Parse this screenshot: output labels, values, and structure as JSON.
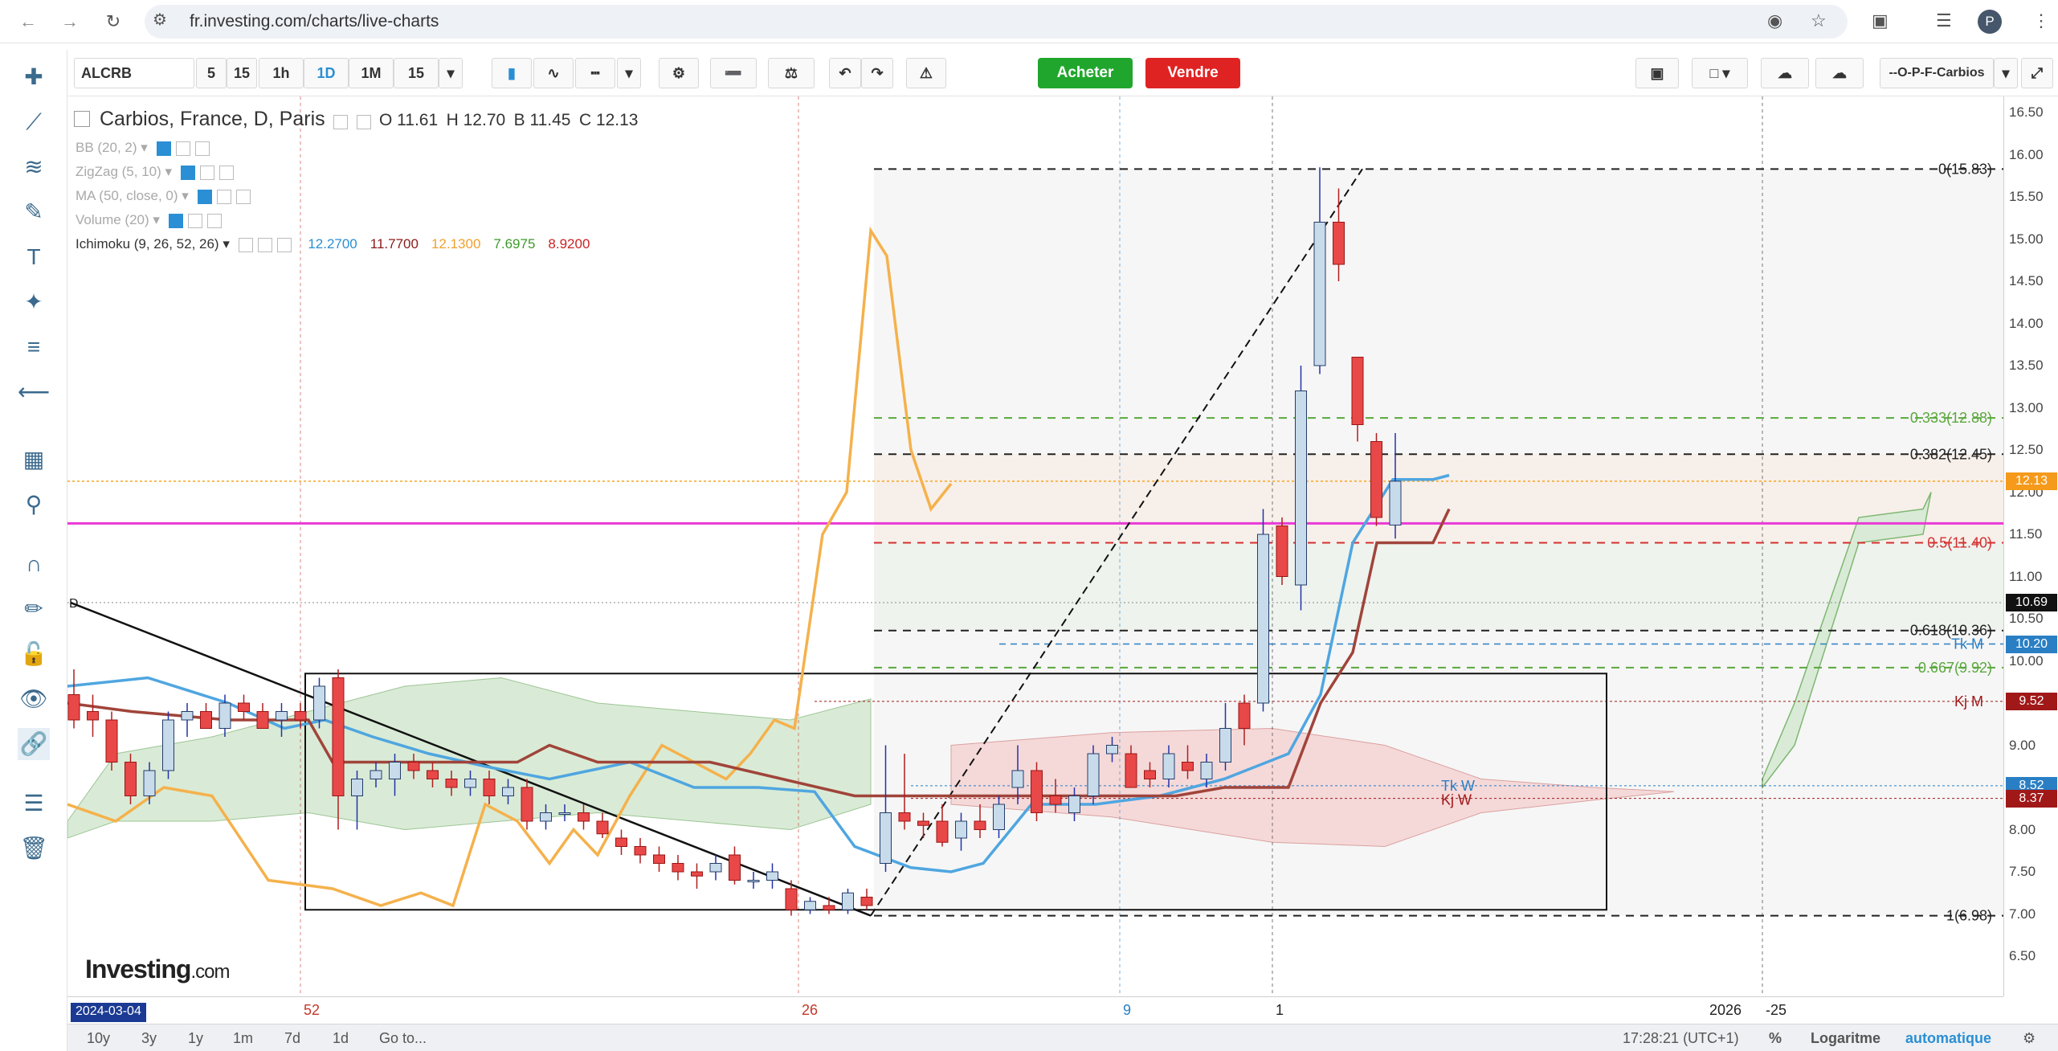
{
  "browser": {
    "url": "fr.investing.com/charts/live-charts",
    "profile_initial": "P"
  },
  "toolbar": {
    "symbol": "ALCRB",
    "intervals": [
      "5",
      "15",
      "1h",
      "1D",
      "1M",
      "15"
    ],
    "active_interval": "1D",
    "buy_label": "Acheter",
    "sell_label": "Vendre",
    "layout_name": "--O-P-F-Carbios"
  },
  "legend": {
    "title": "Carbios, France, D, Paris",
    "ohlc": {
      "open": "O 11.61",
      "high": "H 12.70",
      "low": "B 11.45",
      "close": "C 12.13"
    },
    "indicators": [
      {
        "label": "BB (20, 2)"
      },
      {
        "label": "ZigZag (5, 10)"
      },
      {
        "label": "MA (50, close, 0)"
      },
      {
        "label": "Volume (20)"
      },
      {
        "label": "Ichimoku (9, 26, 52, 26)"
      }
    ],
    "ichimoku_values": [
      {
        "value": "12.2700",
        "color": "#2a8fd4"
      },
      {
        "value": "11.7700",
        "color": "#8b1a1a"
      },
      {
        "value": "12.1300",
        "color": "#f0a030"
      },
      {
        "value": "7.6975",
        "color": "#3d9a2a"
      },
      {
        "value": "8.9200",
        "color": "#cc2222"
      }
    ]
  },
  "price_axis": {
    "ticks": [
      "16.50",
      "16.00",
      "15.50",
      "15.00",
      "14.50",
      "14.00",
      "13.50",
      "13.00",
      "12.50",
      "12.00",
      "11.50",
      "11.00",
      "10.50",
      "10.00",
      "9.50",
      "9.00",
      "8.50",
      "8.00",
      "7.50",
      "7.00",
      "6.50"
    ],
    "tags": [
      {
        "label": "12.13",
        "color": "#f59a1b"
      },
      {
        "label": "10.69",
        "color": "#111111"
      },
      {
        "label": "10.20",
        "color": "#2a7fc4"
      },
      {
        "label": "9.52",
        "color": "#a01818"
      },
      {
        "label": "8.52",
        "color": "#2a7fc4"
      },
      {
        "label": "8.37",
        "color": "#a01818"
      }
    ]
  },
  "fib_levels": [
    {
      "label": "0(15.83)",
      "color": "#222222"
    },
    {
      "label": "0.333(12.88)",
      "color": "#5aa83c"
    },
    {
      "label": "0.382(12.45)",
      "color": "#222222"
    },
    {
      "label": "0.5(11.40)",
      "color": "#d43030"
    },
    {
      "label": "0.618(10.36)",
      "color": "#222222"
    },
    {
      "label": "0.667(9.92)",
      "color": "#5aa83c"
    },
    {
      "label": "1(6.98)",
      "color": "#222222"
    }
  ],
  "chart_annotations": {
    "tk_m": "Tk M",
    "kj_m": "Kj M",
    "tk_w": "Tk W",
    "kj_w": "Kj W",
    "d_marker": "D"
  },
  "time_axis": {
    "labels": [
      {
        "label": "52",
        "color": "#c0392b"
      },
      {
        "label": "26",
        "color": "#c0392b"
      },
      {
        "label": "9",
        "color": "#2a7fc4"
      },
      {
        "label": "1",
        "color": "#222222"
      },
      {
        "label": "2026",
        "color": "#222222"
      },
      {
        "label": "-25",
        "color": "#222222"
      }
    ],
    "start_date": "2024-03-04"
  },
  "footer": {
    "ranges": [
      "10y",
      "3y",
      "1y",
      "1m",
      "7d",
      "1d",
      "Go to..."
    ],
    "clock": "17:28:21 (UTC+1)",
    "percent": "%",
    "log": "Logaritme",
    "auto": "automatique"
  },
  "logo": {
    "main": "Investing",
    "suffix": ".com"
  },
  "chart_data": {
    "type": "candlestick",
    "title": "Carbios, France, D, Paris",
    "ylim": [
      6.5,
      16.5
    ],
    "candles": [
      {
        "o": 9.6,
        "h": 9.9,
        "l": 9.2,
        "c": 9.3
      },
      {
        "o": 9.4,
        "h": 9.6,
        "l": 9.1,
        "c": 9.3
      },
      {
        "o": 9.3,
        "h": 9.4,
        "l": 8.7,
        "c": 8.8
      },
      {
        "o": 8.8,
        "h": 8.9,
        "l": 8.3,
        "c": 8.4
      },
      {
        "o": 8.4,
        "h": 8.8,
        "l": 8.3,
        "c": 8.7
      },
      {
        "o": 8.7,
        "h": 9.4,
        "l": 8.6,
        "c": 9.3
      },
      {
        "o": 9.3,
        "h": 9.5,
        "l": 9.1,
        "c": 9.4
      },
      {
        "o": 9.4,
        "h": 9.5,
        "l": 9.2,
        "c": 9.2
      },
      {
        "o": 9.2,
        "h": 9.6,
        "l": 9.1,
        "c": 9.5
      },
      {
        "o": 9.5,
        "h": 9.6,
        "l": 9.3,
        "c": 9.4
      },
      {
        "o": 9.4,
        "h": 9.5,
        "l": 9.2,
        "c": 9.2
      },
      {
        "o": 9.3,
        "h": 9.5,
        "l": 9.1,
        "c": 9.4
      },
      {
        "o": 9.4,
        "h": 9.5,
        "l": 9.2,
        "c": 9.3
      },
      {
        "o": 9.3,
        "h": 9.8,
        "l": 9.2,
        "c": 9.7
      },
      {
        "o": 9.8,
        "h": 9.9,
        "l": 8.0,
        "c": 8.4
      },
      {
        "o": 8.4,
        "h": 8.7,
        "l": 8.0,
        "c": 8.6
      },
      {
        "o": 8.6,
        "h": 8.8,
        "l": 8.5,
        "c": 8.7
      },
      {
        "o": 8.6,
        "h": 8.9,
        "l": 8.4,
        "c": 8.8
      },
      {
        "o": 8.8,
        "h": 8.9,
        "l": 8.6,
        "c": 8.7
      },
      {
        "o": 8.7,
        "h": 8.8,
        "l": 8.5,
        "c": 8.6
      },
      {
        "o": 8.6,
        "h": 8.7,
        "l": 8.4,
        "c": 8.5
      },
      {
        "o": 8.5,
        "h": 8.7,
        "l": 8.4,
        "c": 8.6
      },
      {
        "o": 8.6,
        "h": 8.7,
        "l": 8.3,
        "c": 8.4
      },
      {
        "o": 8.4,
        "h": 8.6,
        "l": 8.3,
        "c": 8.5
      },
      {
        "o": 8.5,
        "h": 8.6,
        "l": 8.0,
        "c": 8.1
      },
      {
        "o": 8.1,
        "h": 8.3,
        "l": 8.0,
        "c": 8.2
      },
      {
        "o": 8.2,
        "h": 8.3,
        "l": 8.1,
        "c": 8.2
      },
      {
        "o": 8.2,
        "h": 8.3,
        "l": 8.0,
        "c": 8.1
      },
      {
        "o": 8.1,
        "h": 8.2,
        "l": 7.9,
        "c": 7.95
      },
      {
        "o": 7.9,
        "h": 8.0,
        "l": 7.7,
        "c": 7.8
      },
      {
        "o": 7.8,
        "h": 7.9,
        "l": 7.6,
        "c": 7.7
      },
      {
        "o": 7.7,
        "h": 7.8,
        "l": 7.5,
        "c": 7.6
      },
      {
        "o": 7.6,
        "h": 7.7,
        "l": 7.4,
        "c": 7.5
      },
      {
        "o": 7.5,
        "h": 7.6,
        "l": 7.3,
        "c": 7.45
      },
      {
        "o": 7.5,
        "h": 7.7,
        "l": 7.4,
        "c": 7.6
      },
      {
        "o": 7.7,
        "h": 7.8,
        "l": 7.35,
        "c": 7.4
      },
      {
        "o": 7.4,
        "h": 7.5,
        "l": 7.3,
        "c": 7.4
      },
      {
        "o": 7.4,
        "h": 7.6,
        "l": 7.3,
        "c": 7.5
      },
      {
        "o": 7.3,
        "h": 7.4,
        "l": 6.98,
        "c": 7.05
      },
      {
        "o": 7.05,
        "h": 7.2,
        "l": 7.0,
        "c": 7.15
      },
      {
        "o": 7.1,
        "h": 7.2,
        "l": 7.0,
        "c": 7.05
      },
      {
        "o": 7.05,
        "h": 7.3,
        "l": 7.0,
        "c": 7.25
      },
      {
        "o": 7.2,
        "h": 7.3,
        "l": 7.05,
        "c": 7.1
      },
      {
        "o": 7.6,
        "h": 9.0,
        "l": 7.5,
        "c": 8.2
      },
      {
        "o": 8.2,
        "h": 8.9,
        "l": 8.0,
        "c": 8.1
      },
      {
        "o": 8.1,
        "h": 8.2,
        "l": 7.9,
        "c": 8.05
      },
      {
        "o": 8.1,
        "h": 8.3,
        "l": 7.8,
        "c": 7.85
      },
      {
        "o": 7.9,
        "h": 8.2,
        "l": 7.75,
        "c": 8.1
      },
      {
        "o": 8.1,
        "h": 8.3,
        "l": 7.9,
        "c": 8.0
      },
      {
        "o": 8.0,
        "h": 8.4,
        "l": 7.9,
        "c": 8.3
      },
      {
        "o": 8.5,
        "h": 9.0,
        "l": 8.3,
        "c": 8.7
      },
      {
        "o": 8.7,
        "h": 8.8,
        "l": 8.1,
        "c": 8.2
      },
      {
        "o": 8.4,
        "h": 8.6,
        "l": 8.2,
        "c": 8.3
      },
      {
        "o": 8.2,
        "h": 8.5,
        "l": 8.1,
        "c": 8.4
      },
      {
        "o": 8.4,
        "h": 9.0,
        "l": 8.3,
        "c": 8.9
      },
      {
        "o": 8.9,
        "h": 9.1,
        "l": 8.8,
        "c": 9.0
      },
      {
        "o": 8.9,
        "h": 9.0,
        "l": 8.5,
        "c": 8.5
      },
      {
        "o": 8.7,
        "h": 8.8,
        "l": 8.5,
        "c": 8.6
      },
      {
        "o": 8.6,
        "h": 9.0,
        "l": 8.5,
        "c": 8.9
      },
      {
        "o": 8.8,
        "h": 9.0,
        "l": 8.6,
        "c": 8.7
      },
      {
        "o": 8.6,
        "h": 8.9,
        "l": 8.5,
        "c": 8.8
      },
      {
        "o": 8.8,
        "h": 9.5,
        "l": 8.7,
        "c": 9.2
      },
      {
        "o": 9.5,
        "h": 9.6,
        "l": 9.0,
        "c": 9.2
      },
      {
        "o": 9.5,
        "h": 11.8,
        "l": 9.4,
        "c": 11.5
      },
      {
        "o": 11.6,
        "h": 11.7,
        "l": 10.9,
        "c": 11.0
      },
      {
        "o": 10.9,
        "h": 13.5,
        "l": 10.6,
        "c": 13.2
      },
      {
        "o": 13.5,
        "h": 15.85,
        "l": 13.4,
        "c": 15.2
      },
      {
        "o": 15.2,
        "h": 15.6,
        "l": 14.5,
        "c": 14.7
      },
      {
        "o": 13.6,
        "h": 13.6,
        "l": 12.6,
        "c": 12.8
      },
      {
        "o": 12.6,
        "h": 12.7,
        "l": 11.6,
        "c": 11.7
      },
      {
        "o": 11.61,
        "h": 12.7,
        "l": 11.45,
        "c": 12.13
      }
    ]
  }
}
